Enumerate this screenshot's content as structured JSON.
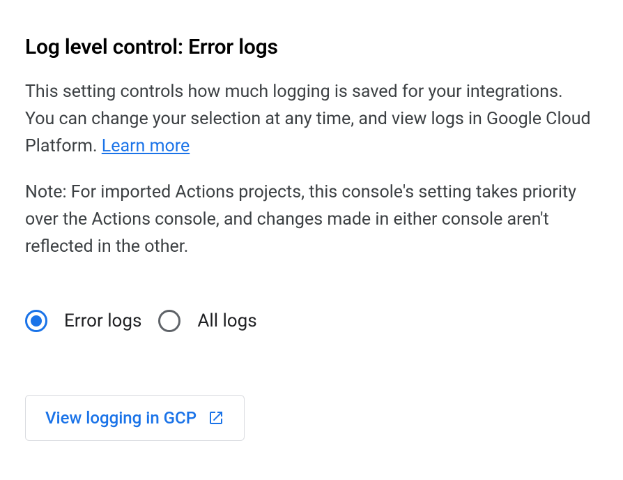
{
  "heading": "Log level control: Error logs",
  "description_text": "This setting controls how much logging is saved for your integrations. You can change your selection at any time, and view logs in Google Cloud Platform. ",
  "learn_more_label": "Learn more",
  "note_text": "Note: For imported Actions projects, this console's setting takes priority over the Actions console, and changes made in either console aren't reflected in the other.",
  "radio_options": {
    "error_logs": "Error logs",
    "all_logs": "All logs"
  },
  "selected_option": "error_logs",
  "view_button_label": "View logging in GCP",
  "colors": {
    "link": "#1a73e8",
    "text": "#3c4043",
    "heading": "#000000",
    "border": "#dadce0",
    "radio_unselected": "#5f6368"
  }
}
